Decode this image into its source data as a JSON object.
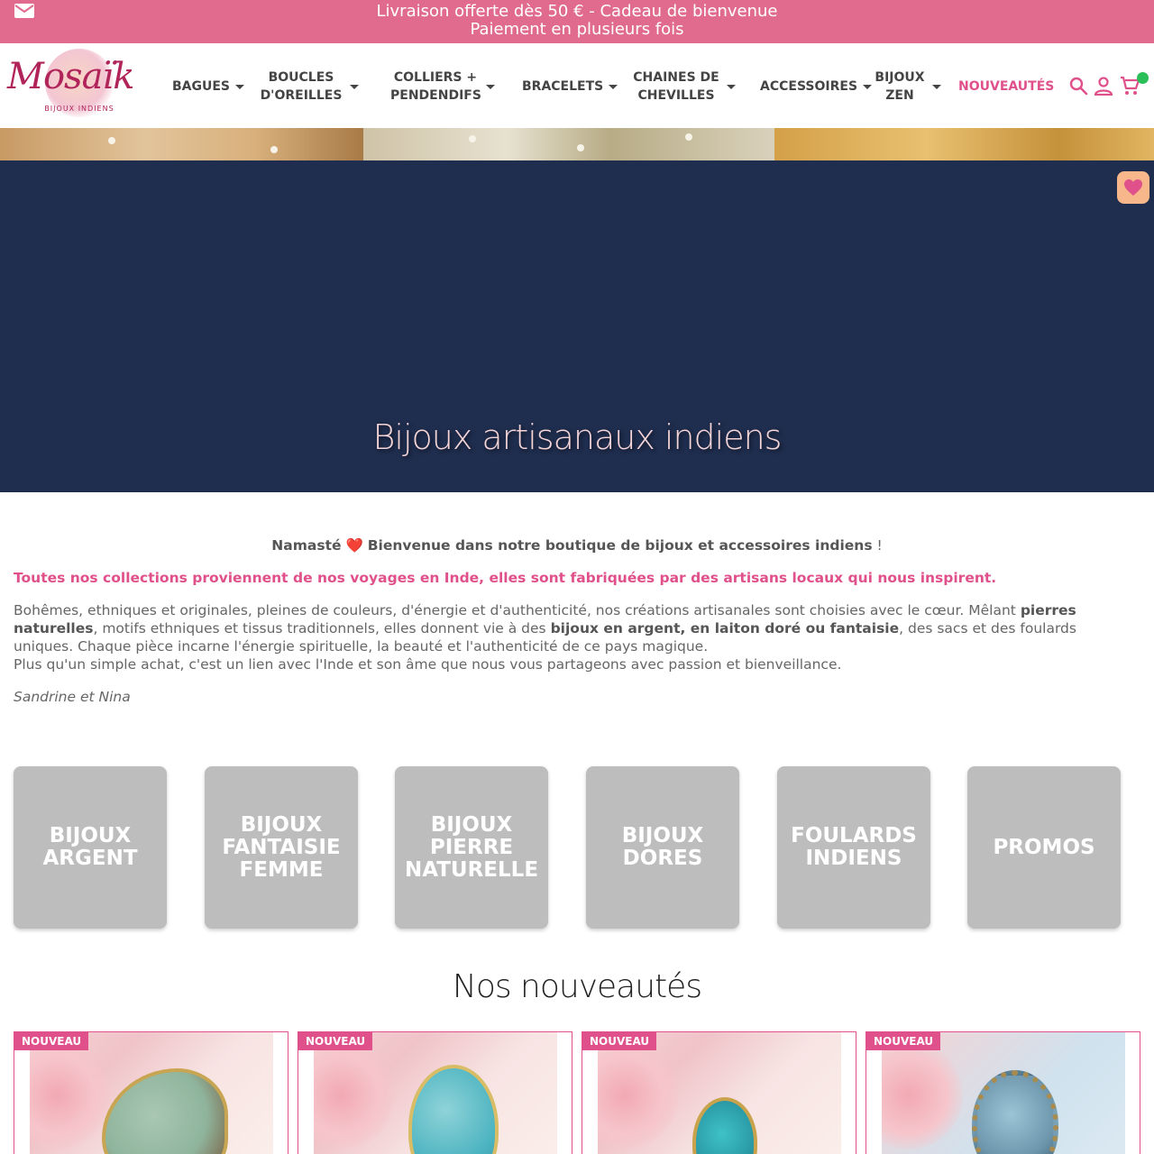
{
  "topbar": {
    "line1": "Livraison offerte dès 50 € - Cadeau de bienvenue",
    "line2": "Paiement en plusieurs fois",
    "icon": "mail-icon"
  },
  "logo": {
    "name": "Mosaïk",
    "tagline": "BIJOUX INDIENS"
  },
  "nav": {
    "items": [
      {
        "label": "BAGUES",
        "has_dropdown": true
      },
      {
        "label": "BOUCLES D'OREILLES",
        "has_dropdown": true
      },
      {
        "label": "COLLIERS + PENDENDIFS",
        "has_dropdown": true
      },
      {
        "label": "BRACELETS",
        "has_dropdown": true
      },
      {
        "label": "CHAINES DE CHEVILLES",
        "has_dropdown": true
      },
      {
        "label": "ACCESSOIRES",
        "has_dropdown": true
      },
      {
        "label": "BIJOUX ZEN",
        "has_dropdown": true
      },
      {
        "label": "NOUVEAUTÉS",
        "has_dropdown": false
      }
    ],
    "icons": [
      "search-icon",
      "user-icon",
      "cart-icon"
    ]
  },
  "hero": {
    "title": "Bijoux artisanaux indiens"
  },
  "intro": {
    "welcome_prefix": "Namasté",
    "heart": "❤️",
    "welcome_bold": "Bienvenue dans notre boutique de bijoux et accessoires indiens",
    "welcome_suffix": "!",
    "pink_line": "Toutes nos collections proviennent de nos voyages en Inde, elles sont fabriquées par des artisans locaux qui nous inspirent.",
    "p1_a": "Bohêmes, ethniques et originales, pleines de couleurs, d'énergie et d'authenticité, nos créations artisanales sont choisies avec le cœur. Mêlant ",
    "p1_b": "pierres naturelles",
    "p1_c": ", motifs ethniques et tissus traditionnels, elles donnent vie à des ",
    "p1_d": "bijoux en argent, en laiton doré ou fantaisie",
    "p1_e": ", des sacs et des foulards uniques. Chaque pièce incarne l'énergie spirituelle, la beauté et l'authenticité de ce pays magique.",
    "p2": "Plus qu'un simple achat, c'est un lien avec l'Inde et son âme que nous vous partageons avec passion et bienveillance.",
    "signature": "Sandrine et Nina"
  },
  "categories": [
    "BIJOUX ARGENT",
    "BIJOUX FANTAISIE FEMME",
    "BIJOUX PIERRE NATURELLE",
    "BIJOUX DORES",
    "FOULARDS INDIENS",
    "PROMOS"
  ],
  "new_section": {
    "title": "Nos nouveautés",
    "badge": "NOUVEAU"
  },
  "colors": {
    "brand_pink": "#e0508a",
    "topbar": "#e06b8f",
    "hero_bg": "#1f2d4e",
    "tile_bg": "#bdbdbd"
  }
}
